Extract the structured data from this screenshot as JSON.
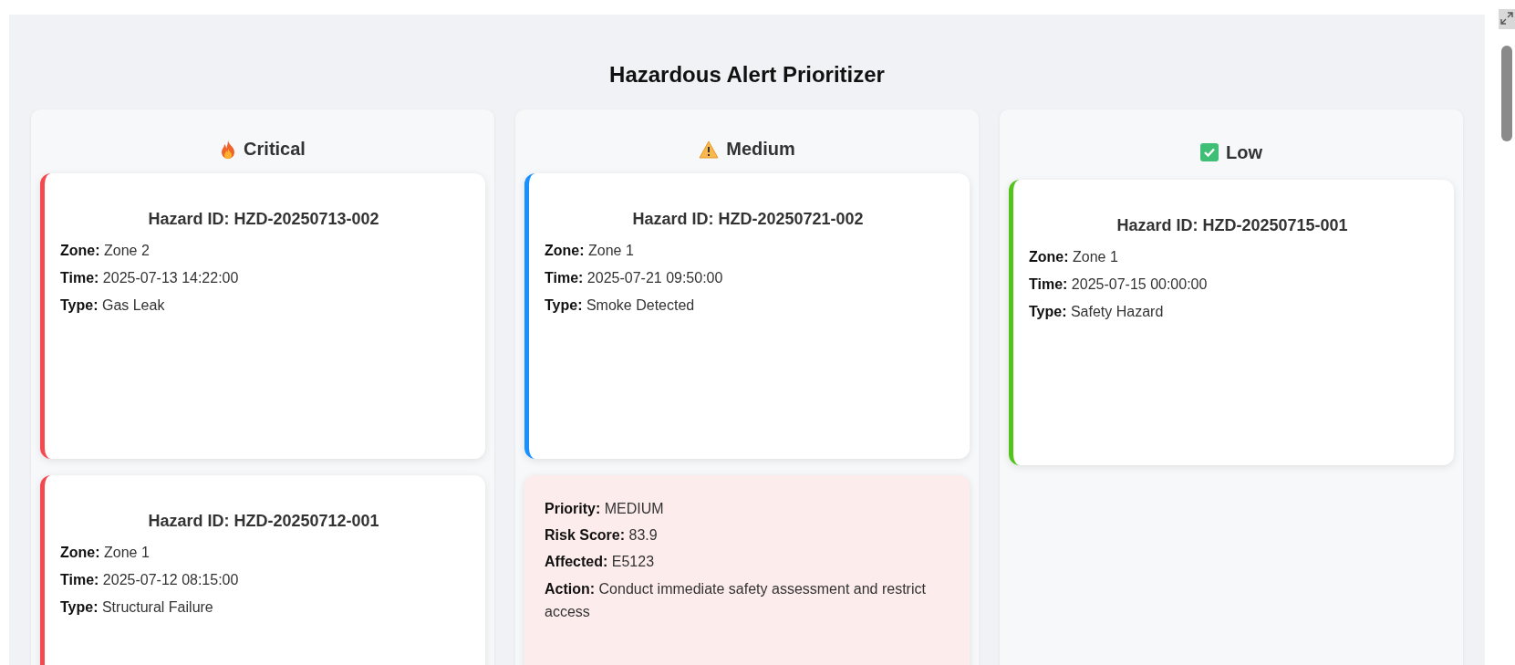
{
  "title": "Hazardous Alert Prioritizer",
  "columns": [
    {
      "kind": "critical",
      "label": "Critical",
      "cards": [
        {
          "kind": "alert",
          "color": "#f5484f",
          "heading": "Hazard ID: HZD-20250713-002",
          "fields": [
            "**Zone:** Zone 2",
            "**Time:** 2025-07-13 14:22:00",
            "**Type:** Gas Leak"
          ]
        },
        {
          "kind": "alert",
          "color": "#f5484f",
          "heading": "Hazard ID: HZD-20250712-001",
          "fields": [
            "**Zone:** Zone 1",
            "**Time:** 2025-07-12 08:15:00",
            "**Type:** Structural Failure"
          ]
        }
      ]
    },
    {
      "kind": "medium",
      "label": "Medium",
      "cards": [
        {
          "kind": "alert",
          "color": "#1890ff",
          "heading": "Hazard ID: HZD-20250721-002",
          "fields": [
            "**Zone:** Zone 1",
            "**Time:** 2025-07-21 09:50:00",
            "**Type:** Smoke Detected"
          ]
        },
        {
          "kind": "detail",
          "fields": [
            "**Priority:** MEDIUM",
            "**Risk Score:** 83.9",
            "**Affected:** E5123",
            "**Action:** Conduct immediate safety assessment and restrict access"
          ]
        }
      ]
    },
    {
      "kind": "low",
      "label": "Low",
      "cards": [
        {
          "kind": "alert",
          "color": "#52c41a",
          "heading": "Hazard ID: HZD-20250715-001",
          "fields": [
            "**Zone:** Zone 1",
            "**Time:** 2025-07-15 00:00:00",
            "**Type:** Safety Hazard"
          ]
        }
      ]
    }
  ]
}
